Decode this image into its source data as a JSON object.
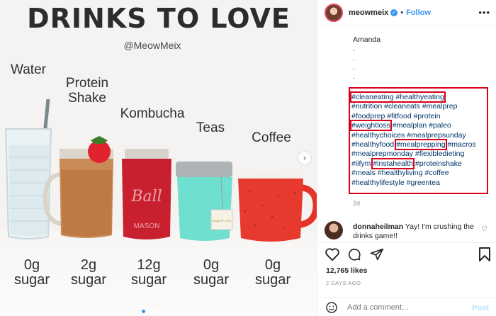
{
  "photo": {
    "title": "DRINKS TO LOVE",
    "handle": "@MeowMeix",
    "drinks": [
      {
        "name_line1": "Water",
        "name_line2": "",
        "sugar_amount": "0g",
        "sugar_word": "sugar"
      },
      {
        "name_line1": "Protein",
        "name_line2": "Shake",
        "sugar_amount": "2g",
        "sugar_word": "sugar"
      },
      {
        "name_line1": "Kombucha",
        "name_line2": "",
        "sugar_amount": "12g",
        "sugar_word": "sugar"
      },
      {
        "name_line1": "Teas",
        "name_line2": "",
        "sugar_amount": "0g",
        "sugar_word": "sugar"
      },
      {
        "name_line1": "Coffee",
        "name_line2": "",
        "sugar_amount": "0g",
        "sugar_word": "sugar"
      }
    ],
    "jar_lettering": "Ball",
    "jar_bottom_text": "MASON",
    "tea_tag_text": "HEALTHY TEA"
  },
  "header": {
    "username": "meowmeix",
    "follow_label": "Follow",
    "separator": "•",
    "more_label": "•••"
  },
  "caption": {
    "signature": "Amanda",
    "dots": [
      ".",
      ".",
      ".",
      "."
    ],
    "hashtag_lines": [
      [
        "#cleaneating",
        "#healthyeating"
      ],
      [
        "#nutrition",
        "#cleaneats",
        "#mealprep"
      ],
      [
        "#foodprep",
        "#fitfood",
        "#protein"
      ],
      [
        "#weightloss",
        "#mealplan",
        "#paleo"
      ],
      [
        "#healthychoices",
        "#mealprepsunday"
      ],
      [
        "#healthyfood",
        "#mealprepping",
        "#macros"
      ],
      [
        "#mealprepmonday",
        "#flexibledieting"
      ],
      [
        "#iifym",
        "#instahealth",
        "#proteinshake"
      ],
      [
        "#meals",
        "#healthyliving",
        "#coffee"
      ],
      [
        "#healthylifestyle",
        "#greentea"
      ]
    ],
    "time_ago": "2d"
  },
  "comment": {
    "username": "donnaheilman",
    "text": "Yay! I'm crushing the drinks game!!"
  },
  "stats": {
    "likes": "12,765 likes",
    "posted": "2 DAYS AGO"
  },
  "add_comment": {
    "placeholder": "Add a comment...",
    "post_label": "Post"
  },
  "colors": {
    "highlight": "#d9001b",
    "link": "#003569",
    "follow": "#3897f0"
  }
}
